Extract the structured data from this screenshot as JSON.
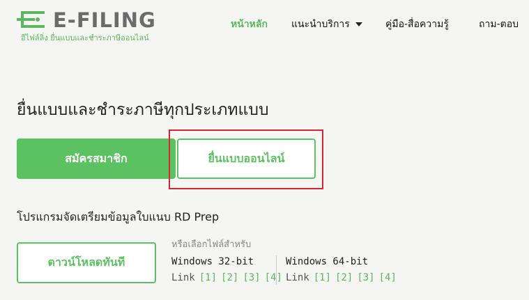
{
  "logo": {
    "title": "E-FILING",
    "subtitle": "อีไฟล์ลิ่ง ยื่นแบบและชำระภาษีออนไลน์",
    "accent": "#5bb75b"
  },
  "nav": {
    "items": [
      {
        "label": "หน้าหลัก",
        "active": true
      },
      {
        "label": "แนะนำบริการ",
        "dropdown": true
      },
      {
        "label": "คู่มือ-สื่อความรู้"
      },
      {
        "label": "ถาม-ตอบ"
      }
    ]
  },
  "main": {
    "heading": "ยื่นแบบและชำระภาษีทุกประเภทแบบ",
    "register_label": "สมัครสมาชิก",
    "file_online_label": "ยื่นแบบออนไลน์",
    "highlight_color": "#d9232d"
  },
  "rdprep": {
    "heading": "โปรแกรมจัดเตรียมข้อมูลใบแนบ RD Prep",
    "download_label": "ดาวน์โหลดทันที",
    "choose_text": "หรือเลือกไฟล์สำหรับ",
    "win32": {
      "title": "Windows 32-bit",
      "link_label": "Link",
      "links": [
        "[1]",
        "[2]",
        "[3]",
        "[4]"
      ]
    },
    "win64": {
      "title": "Windows 64-bit",
      "link_label": "Link",
      "links": [
        "[1]",
        "[2]",
        "[3]",
        "[4]"
      ]
    }
  }
}
